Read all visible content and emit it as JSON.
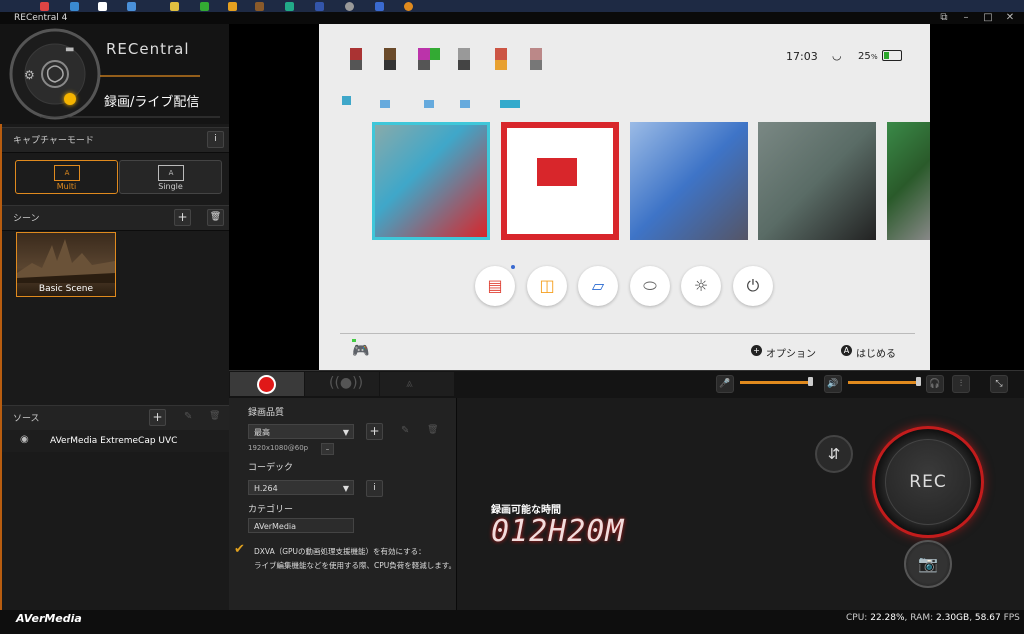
{
  "window": {
    "title": "RECentral 4",
    "minimize": "–",
    "maximize": "□",
    "close": "✕",
    "restore": "⧉"
  },
  "brand": {
    "logo_text": "RECentral",
    "mode_title": "録画/ライブ配信",
    "footer_brand": "AVerMedia"
  },
  "capture_mode": {
    "header": "キャプチャーモード",
    "info": "i",
    "options": [
      {
        "icon_text": "A",
        "label": "Multi",
        "active": true
      },
      {
        "icon_text": "A",
        "label": "Single",
        "active": false
      }
    ]
  },
  "scenes": {
    "header": "シーン",
    "add": "+",
    "delete": "🗑",
    "items": [
      {
        "label": "Basic Scene"
      }
    ]
  },
  "sources": {
    "header": "ソース",
    "add": "+",
    "edit": "✎",
    "delete": "🗑",
    "items": [
      {
        "label": "AVerMedia ExtremeCap UVC"
      }
    ]
  },
  "preview": {
    "clock": "17:03",
    "battery": "25",
    "battery_unit": "%",
    "footer_options": "オプション",
    "footer_start": "はじめる",
    "footer_start_btn": "A",
    "footer_options_btn": "+",
    "tile_colors": [
      "#3fa7c9",
      "#d8262b",
      "#3e74c7",
      "#5a6c66",
      "#3a8a48"
    ],
    "home_icons": [
      "news-icon",
      "shop-icon",
      "album-icon",
      "controller-icon",
      "settings-icon",
      "power-icon"
    ]
  },
  "record_settings": {
    "quality_label": "録画品質",
    "quality_value": "最高",
    "resolution": "1920x1080@60p",
    "codec_label": "コーデック",
    "codec_value": "H.264",
    "category_label": "カテゴリー",
    "category_value": "AVerMedia",
    "dxva_label": "DXVA（GPUの動画処理支援機能）を有効にする：",
    "dxva_note": "ライブ編集機能などを使用する際、CPU負荷を軽減します。",
    "dxva_checked": true
  },
  "audio": {
    "mic_level": 0.95,
    "speaker_level": 0.95
  },
  "status": {
    "time_label": "録画可能な時間",
    "time_value": "012H20M",
    "rec_label": "REC",
    "cpu_label": "CPU:",
    "cpu_value": "22.28%",
    "ram_label": "RAM:",
    "ram_value": "2.30GB",
    "fps_value": "58.67",
    "fps_label": "FPS"
  },
  "colors": {
    "accent": "#e08a1e",
    "rec_red": "#c31c1c"
  }
}
